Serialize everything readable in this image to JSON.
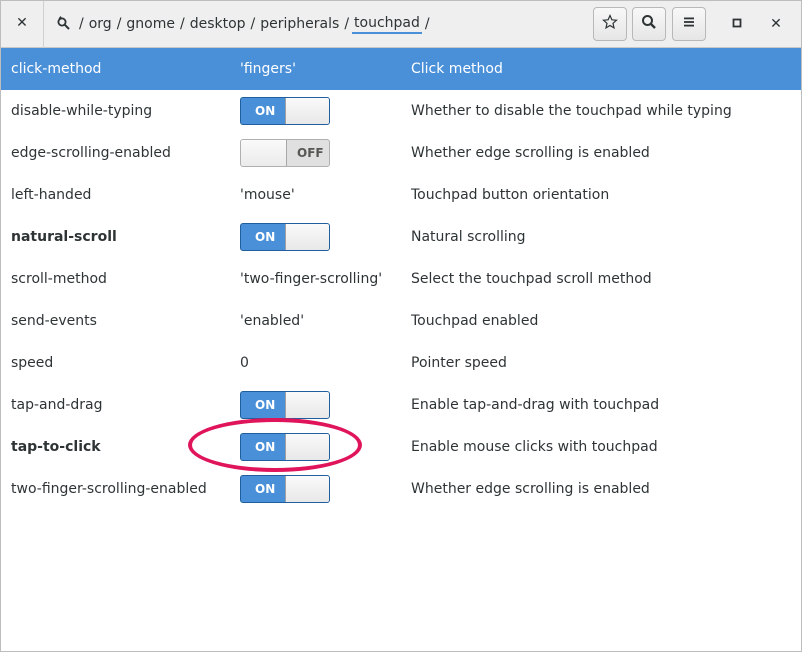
{
  "header": {
    "close_label": "✕",
    "path_root": "/",
    "path": [
      "org",
      "gnome",
      "desktop",
      "peripherals",
      "touchpad"
    ],
    "path_trailing": "/",
    "minimize_label": "□",
    "window_close_label": "✕"
  },
  "rows": [
    {
      "name": "click-method",
      "value": "'fingers'",
      "desc": "Click method",
      "selected": true
    },
    {
      "name": "disable-while-typing",
      "switch": "ON",
      "desc": "Whether to disable the touchpad while typing"
    },
    {
      "name": "edge-scrolling-enabled",
      "switch": "OFF",
      "desc": "Whether edge scrolling is enabled"
    },
    {
      "name": "left-handed",
      "value": "'mouse'",
      "desc": "Touchpad button orientation"
    },
    {
      "name": "natural-scroll",
      "switch": "ON",
      "desc": "Natural scrolling",
      "bold": true
    },
    {
      "name": "scroll-method",
      "value": "'two-finger-scrolling'",
      "desc": "Select the touchpad scroll method"
    },
    {
      "name": "send-events",
      "value": "'enabled'",
      "desc": "Touchpad enabled"
    },
    {
      "name": "speed",
      "value": "0",
      "desc": "Pointer speed"
    },
    {
      "name": "tap-and-drag",
      "switch": "ON",
      "desc": "Enable tap-and-drag with touchpad"
    },
    {
      "name": "tap-to-click",
      "switch": "ON",
      "desc": "Enable mouse clicks with touchpad",
      "bold": true
    },
    {
      "name": "two-finger-scrolling-enabled",
      "switch": "ON",
      "desc": "Whether edge scrolling is enabled"
    }
  ],
  "colors": {
    "selection": "#4a90d9",
    "highlight_annotation": "#e0145a"
  },
  "icons": {
    "path_root": "search-root-icon",
    "bookmark": "star-icon",
    "search": "search-icon",
    "menu": "hamburger-menu-icon"
  }
}
